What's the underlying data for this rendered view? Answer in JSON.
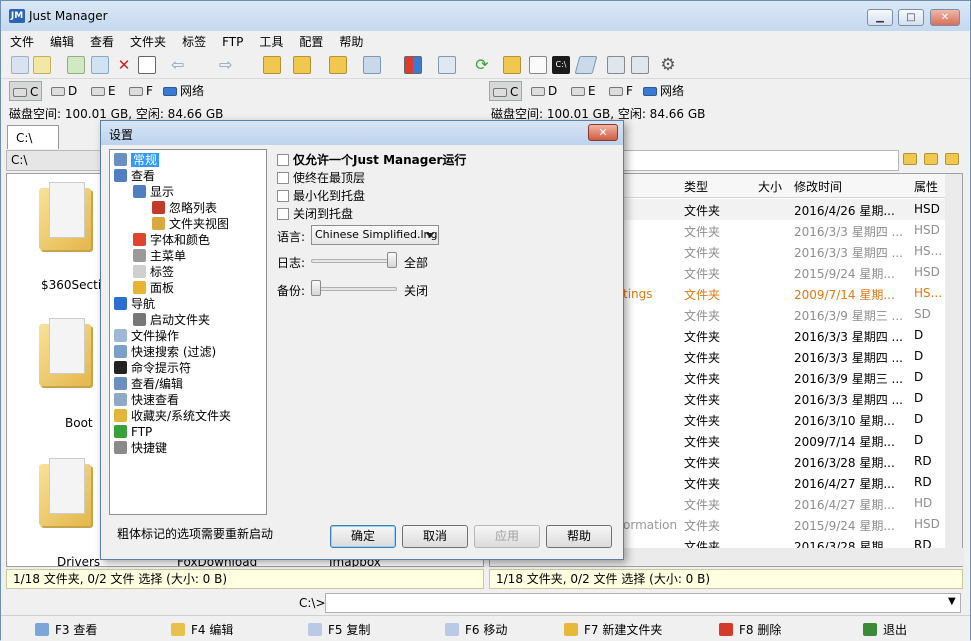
{
  "app": {
    "title": "Just Manager",
    "icon_text": "JM"
  },
  "window_buttons": {
    "minimize": "▁",
    "maximize": "□",
    "close": "✕"
  },
  "menu": [
    "文件",
    "编辑",
    "查看",
    "文件夹",
    "标签",
    "FTP",
    "工具",
    "配置",
    "帮助"
  ],
  "drives": {
    "left": [
      {
        "label": "C",
        "active": true
      },
      {
        "label": "D",
        "active": false
      },
      {
        "label": "E",
        "active": false
      },
      {
        "label": "F",
        "active": false
      },
      {
        "label": "网络",
        "active": false
      }
    ],
    "right": [
      {
        "label": "C",
        "active": true
      },
      {
        "label": "D",
        "active": false
      },
      {
        "label": "E",
        "active": false
      },
      {
        "label": "F",
        "active": false
      },
      {
        "label": "网络",
        "active": false
      }
    ]
  },
  "left_panel": {
    "free_space": "磁盘空间: 100.01 GB, 空闲: 84.66 GB",
    "tab": "C:\\",
    "path": "C:\\",
    "folders": [
      "$360Section",
      "Boot",
      "Drivers",
      "FoxDownload",
      "Imapbox"
    ],
    "status": "1/18 文件夹, 0/2 文件 选择 (大小: 0 B)"
  },
  "right_panel": {
    "free_space": "磁盘空间: 100.01 GB, 空闲: 84.66 GB",
    "columns": {
      "type": "类型",
      "size": "大小",
      "modified": "修改时间",
      "attr": "属性"
    },
    "partial_names": {
      "settings": "tings",
      "information": "ormation"
    },
    "rows": [
      {
        "type": "文件夹",
        "date": "2016/4/26 星期...",
        "attr": "HSD",
        "style": "normal"
      },
      {
        "type": "文件夹",
        "date": "2016/3/3 星期四 ...",
        "attr": "HSD",
        "style": "gray"
      },
      {
        "type": "文件夹",
        "date": "2016/3/3 星期四 ...",
        "attr": "HS...",
        "style": "gray"
      },
      {
        "type": "文件夹",
        "date": "2015/9/24 星期...",
        "attr": "HSD",
        "style": "gray"
      },
      {
        "type": "文件夹",
        "date": "2009/7/14 星期...",
        "attr": "HS...",
        "style": "orange"
      },
      {
        "type": "文件夹",
        "date": "2016/3/9 星期三 ...",
        "attr": "SD",
        "style": "gray"
      },
      {
        "type": "文件夹",
        "date": "2016/3/3 星期四 ...",
        "attr": "D",
        "style": "normal"
      },
      {
        "type": "文件夹",
        "date": "2016/3/3 星期四 ...",
        "attr": "D",
        "style": "normal"
      },
      {
        "type": "文件夹",
        "date": "2016/3/9 星期三 ...",
        "attr": "D",
        "style": "normal"
      },
      {
        "type": "文件夹",
        "date": "2016/3/3 星期四 ...",
        "attr": "D",
        "style": "normal"
      },
      {
        "type": "文件夹",
        "date": "2016/3/10 星期...",
        "attr": "D",
        "style": "normal"
      },
      {
        "type": "文件夹",
        "date": "2009/7/14 星期...",
        "attr": "D",
        "style": "normal"
      },
      {
        "type": "文件夹",
        "date": "2016/3/28 星期...",
        "attr": "RD",
        "style": "normal"
      },
      {
        "type": "文件夹",
        "date": "2016/4/27 星期...",
        "attr": "RD",
        "style": "normal"
      },
      {
        "type": "文件夹",
        "date": "2016/4/27 星期...",
        "attr": "HD",
        "style": "gray"
      },
      {
        "type": "文件夹",
        "date": "2015/9/24 星期...",
        "attr": "HSD",
        "style": "gray"
      },
      {
        "type": "文件夹",
        "date": "2016/3/28 星期...",
        "attr": "RD",
        "style": "normal"
      }
    ],
    "status": "1/18 文件夹, 0/2 文件 选择 (大小: 0 B)"
  },
  "cmdline": {
    "prompt": "C:\\>",
    "value": ""
  },
  "fkeys": [
    {
      "label": "F3 查看",
      "color": "#7aa7d8"
    },
    {
      "label": "F4 编辑",
      "color": "#e6c24a"
    },
    {
      "label": "F5 复制",
      "color": "#b9c9e6"
    },
    {
      "label": "F6 移动",
      "color": "#b9c9e6"
    },
    {
      "label": "F7 新建文件夹",
      "color": "#e6b93a"
    },
    {
      "label": "F8 删除",
      "color": "#d23a2a"
    },
    {
      "label": "退出",
      "color": "#3a8a3a"
    }
  ],
  "dialog": {
    "title": "设置",
    "close": "✕",
    "tree": [
      {
        "label": "常规",
        "indent": 0,
        "selected": true,
        "icon": "general-icon"
      },
      {
        "label": "查看",
        "indent": 0,
        "selected": false,
        "icon": "view-icon"
      },
      {
        "label": "显示",
        "indent": 1,
        "selected": false,
        "icon": "display-icon"
      },
      {
        "label": "忽略列表",
        "indent": 2,
        "selected": false,
        "icon": "ignore-list-icon"
      },
      {
        "label": "文件夹视图",
        "indent": 2,
        "selected": false,
        "icon": "folder-view-icon"
      },
      {
        "label": "字体和颜色",
        "indent": 1,
        "selected": false,
        "icon": "font-color-icon"
      },
      {
        "label": "主菜单",
        "indent": 1,
        "selected": false,
        "icon": "main-menu-icon"
      },
      {
        "label": "标签",
        "indent": 1,
        "selected": false,
        "icon": "tabs-icon"
      },
      {
        "label": "面板",
        "indent": 1,
        "selected": false,
        "icon": "panel-icon"
      },
      {
        "label": "导航",
        "indent": 0,
        "selected": false,
        "icon": "navigation-icon"
      },
      {
        "label": "启动文件夹",
        "indent": 1,
        "selected": false,
        "icon": "startup-folder-icon"
      },
      {
        "label": "文件操作",
        "indent": 0,
        "selected": false,
        "icon": "file-ops-icon"
      },
      {
        "label": "快速搜索 (过滤)",
        "indent": 0,
        "selected": false,
        "icon": "quick-search-icon"
      },
      {
        "label": "命令提示符",
        "indent": 0,
        "selected": false,
        "icon": "command-prompt-icon"
      },
      {
        "label": "查看/编辑",
        "indent": 0,
        "selected": false,
        "icon": "view-edit-icon"
      },
      {
        "label": "快速查看",
        "indent": 0,
        "selected": false,
        "icon": "quick-view-icon"
      },
      {
        "label": "收藏夹/系统文件夹",
        "indent": 0,
        "selected": false,
        "icon": "favorites-icon"
      },
      {
        "label": "FTP",
        "indent": 0,
        "selected": false,
        "icon": "ftp-icon"
      },
      {
        "label": "快捷键",
        "indent": 0,
        "selected": false,
        "icon": "hotkeys-icon"
      }
    ],
    "checkboxes": [
      {
        "label": "仅允许一个Just Manager运行",
        "bold": true,
        "checked": false
      },
      {
        "label": "使终在最顶层",
        "bold": false,
        "checked": false
      },
      {
        "label": "最小化到托盘",
        "bold": false,
        "checked": false
      },
      {
        "label": "关闭到托盘",
        "bold": false,
        "checked": false
      }
    ],
    "language_label": "语言:",
    "language_value": "Chinese Simplified.lng",
    "log_label": "日志:",
    "log_value": "全部",
    "log_level": 1.0,
    "backup_label": "备份:",
    "backup_value": "关闭",
    "backup_level": 0.0,
    "footer_note": "粗体标记的选项需要重新启动",
    "buttons": {
      "ok": "确定",
      "cancel": "取消",
      "apply": "应用",
      "help": "帮助"
    }
  }
}
